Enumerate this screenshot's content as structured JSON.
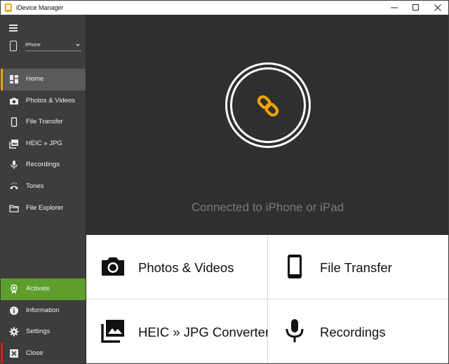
{
  "window": {
    "title": "iDevice Manager",
    "controls": [
      "minimize",
      "maximize",
      "close"
    ]
  },
  "sidebar": {
    "device_select": {
      "value": "iPhone"
    },
    "nav": [
      {
        "label": "Home",
        "icon": "home-dashboard-icon",
        "active": true
      },
      {
        "label": "Photos & Videos",
        "icon": "camera-icon"
      },
      {
        "label": "File Transfer",
        "icon": "phone-icon"
      },
      {
        "label": "HEIC » JPG",
        "icon": "image-gallery-icon"
      },
      {
        "label": "Recordings",
        "icon": "microphone-icon"
      },
      {
        "label": "Tones",
        "icon": "ringtone-phone-icon"
      },
      {
        "label": "File Explorer",
        "icon": "folder-icon"
      }
    ],
    "bottom": [
      {
        "label": "Activate",
        "icon": "certificate-icon"
      },
      {
        "label": "Information",
        "icon": "info-icon"
      },
      {
        "label": "Settings",
        "icon": "gear-icon"
      },
      {
        "label": "Close",
        "icon": "close-box-icon"
      }
    ]
  },
  "hero": {
    "status_text": "Connected to iPhone or iPad",
    "icon": "chain-link-icon"
  },
  "tiles": [
    {
      "label": "Photos & Videos",
      "icon": "camera-icon"
    },
    {
      "label": "File Transfer",
      "icon": "phone-icon"
    },
    {
      "label": "HEIC » JPG Converter",
      "icon": "image-gallery-icon"
    },
    {
      "label": "Recordings",
      "icon": "microphone-icon"
    }
  ],
  "colors": {
    "sidebar_bg": "#3d3d3d",
    "active_item_bg": "#5a5a5a",
    "active_accent": "#f0a500",
    "activate_bg": "#5d9f2a",
    "close_accent": "#e01a1a",
    "hero_bg": "#2f2f2f",
    "link_icon": "#f0a500",
    "status_text": "#7a7a7a"
  }
}
